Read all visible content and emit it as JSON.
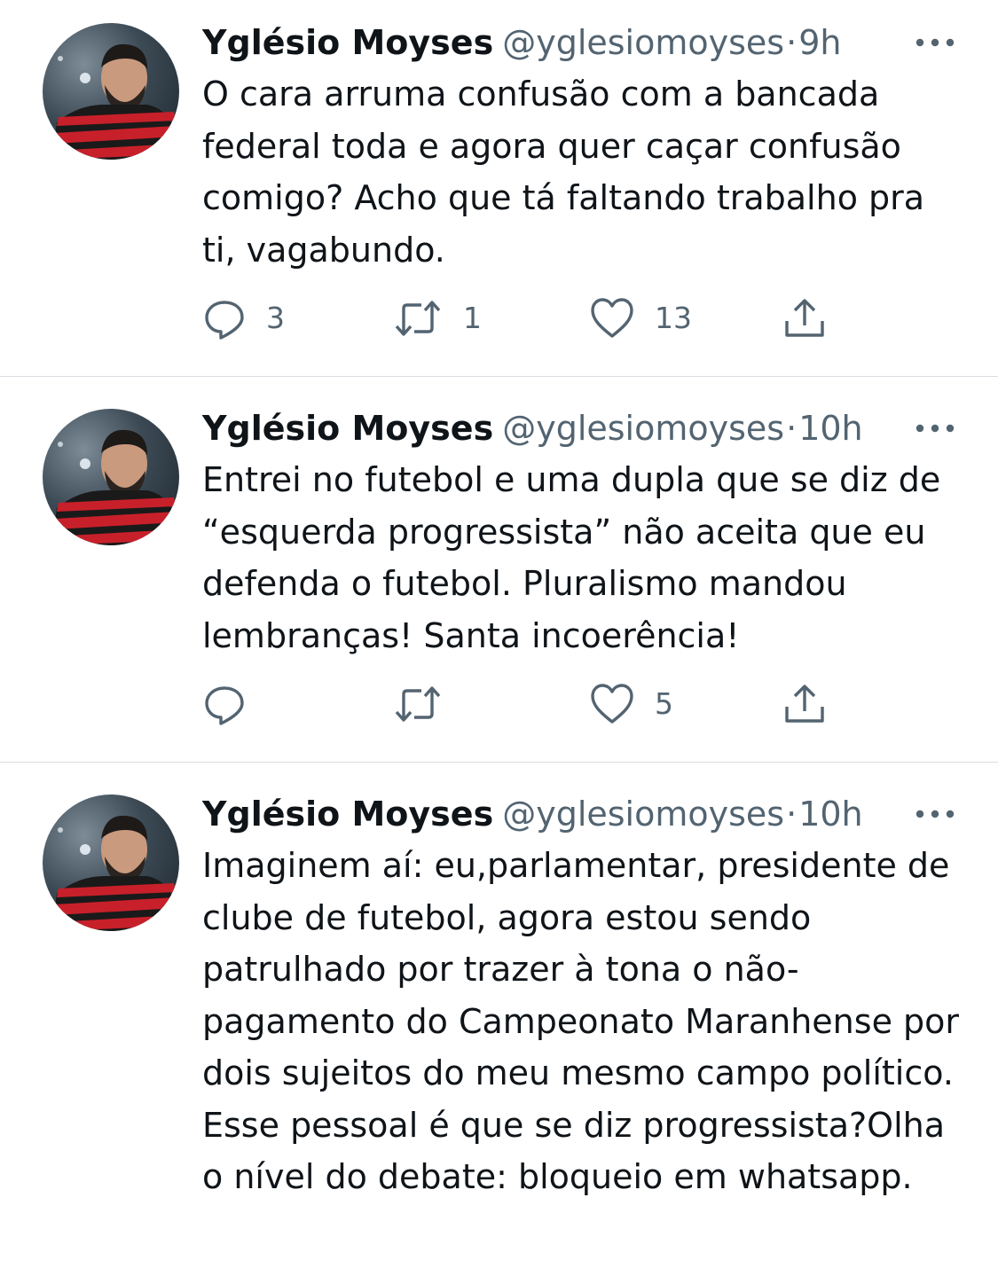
{
  "tweets": [
    {
      "name": "Yglésio Moyses",
      "handle": "@yglesiomoyses",
      "time": "9h",
      "text": "O cara arruma confusão com a bancada federal toda e agora quer caçar confusão comigo? Acho que tá faltando trabalho pra ti, vagabundo.",
      "replies": "3",
      "retweets": "1",
      "likes": "13"
    },
    {
      "name": "Yglésio Moyses",
      "handle": "@yglesiomoyses",
      "time": "10h",
      "text": "Entrei no futebol e uma dupla que se diz de “esquerda progressista” não aceita que eu defenda o futebol. Pluralismo mandou lembranças! Santa incoerência!",
      "replies": "",
      "retweets": "",
      "likes": "5"
    },
    {
      "name": "Yglésio Moyses",
      "handle": "@yglesiomoyses",
      "time": "10h",
      "text": "Imaginem aí: eu,parlamentar, presidente de clube de futebol, agora estou sendo patrulhado por trazer à tona o não-pagamento do Campeonato Maranhense por dois sujeitos do meu mesmo campo político. Esse pessoal é que se diz progressista?Olha o nível do debate: bloqueio em whatsapp."
    }
  ],
  "separator": "·",
  "icons": {
    "reply": "reply-icon",
    "retweet": "retweet-icon",
    "like": "like-icon",
    "share": "share-icon",
    "more": "more-icon"
  },
  "colors": {
    "text": "#0f1419",
    "secondary": "#536471",
    "divider": "#d9dde1"
  }
}
